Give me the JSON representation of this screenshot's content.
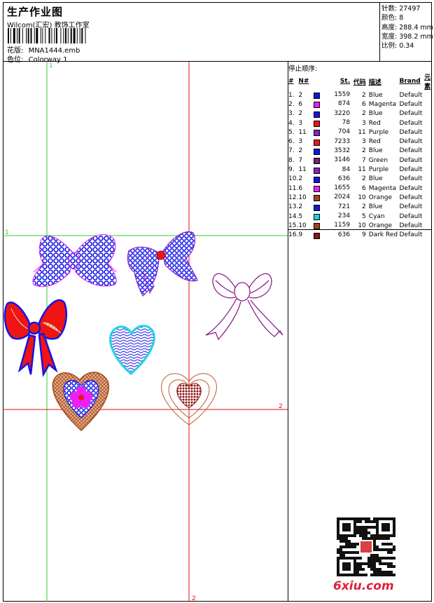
{
  "header": {
    "title": "生产作业图",
    "company": "Wilcom(汇宏) 教饰工作室",
    "file_label": "花版:",
    "file_name": "MNA1444.emb",
    "colorway_label": "色位:",
    "colorway": "Colorway 1"
  },
  "stats": [
    {
      "label": "针数:",
      "value": "27497"
    },
    {
      "label": "颜色:",
      "value": "8"
    },
    {
      "label": "高度:",
      "value": "288.4 mm"
    },
    {
      "label": "宽度:",
      "value": "398.2 mm"
    },
    {
      "label": "比例:",
      "value": "0.34"
    }
  ],
  "stop_sequence": {
    "heading": "停止顺序:",
    "columns": [
      "#",
      "N#",
      "St.",
      "代码",
      "描述",
      "Brand",
      "元素"
    ],
    "rows": [
      {
        "idx": "1.",
        "n": "2",
        "color": "#1414e6",
        "st": "1559",
        "code": "2",
        "desc": "Blue",
        "brand": "Default"
      },
      {
        "idx": "2.",
        "n": "6",
        "color": "#f01ef0",
        "st": "874",
        "code": "6",
        "desc": "Magenta",
        "brand": "Default"
      },
      {
        "idx": "3.",
        "n": "2",
        "color": "#1414e6",
        "st": "3220",
        "code": "2",
        "desc": "Blue",
        "brand": "Default"
      },
      {
        "idx": "4.",
        "n": "3",
        "color": "#f01414",
        "st": "78",
        "code": "3",
        "desc": "Red",
        "brand": "Default"
      },
      {
        "idx": "5.",
        "n": "11",
        "color": "#8c1ec8",
        "st": "704",
        "code": "11",
        "desc": "Purple",
        "brand": "Default"
      },
      {
        "idx": "6.",
        "n": "3",
        "color": "#f01414",
        "st": "7233",
        "code": "3",
        "desc": "Red",
        "brand": "Default"
      },
      {
        "idx": "7.",
        "n": "2",
        "color": "#1414e6",
        "st": "3532",
        "code": "2",
        "desc": "Blue",
        "brand": "Default"
      },
      {
        "idx": "8.",
        "n": "7",
        "color": "#7a1e6e",
        "st": "3146",
        "code": "7",
        "desc": "Green",
        "brand": "Default"
      },
      {
        "idx": "9.",
        "n": "11",
        "color": "#8c1ec8",
        "st": "84",
        "code": "11",
        "desc": "Purple",
        "brand": "Default"
      },
      {
        "idx": "10.",
        "n": "2",
        "color": "#1414e6",
        "st": "636",
        "code": "2",
        "desc": "Blue",
        "brand": "Default"
      },
      {
        "idx": "11.",
        "n": "6",
        "color": "#f01ef0",
        "st": "1655",
        "code": "6",
        "desc": "Magenta",
        "brand": "Default"
      },
      {
        "idx": "12.",
        "n": "10",
        "color": "#a0461e",
        "st": "2024",
        "code": "10",
        "desc": "Orange",
        "brand": "Default"
      },
      {
        "idx": "13.",
        "n": "2",
        "color": "#1414e6",
        "st": "721",
        "code": "2",
        "desc": "Blue",
        "brand": "Default"
      },
      {
        "idx": "14.",
        "n": "5",
        "color": "#1ed2e6",
        "st": "234",
        "code": "5",
        "desc": "Cyan",
        "brand": "Default"
      },
      {
        "idx": "15.",
        "n": "10",
        "color": "#a0461e",
        "st": "1159",
        "code": "10",
        "desc": "Orange",
        "brand": "Default"
      },
      {
        "idx": "16.",
        "n": "9",
        "color": "#8c1414",
        "st": "636",
        "code": "9",
        "desc": "Dark Red",
        "brand": "Default"
      }
    ]
  },
  "guides": {
    "v1": "1",
    "v2": "2",
    "h1": "1",
    "h2": "2"
  },
  "watermark": "6xiu.com",
  "colors": {
    "guide_green": "#33cc33",
    "guide_red": "#e01010"
  }
}
